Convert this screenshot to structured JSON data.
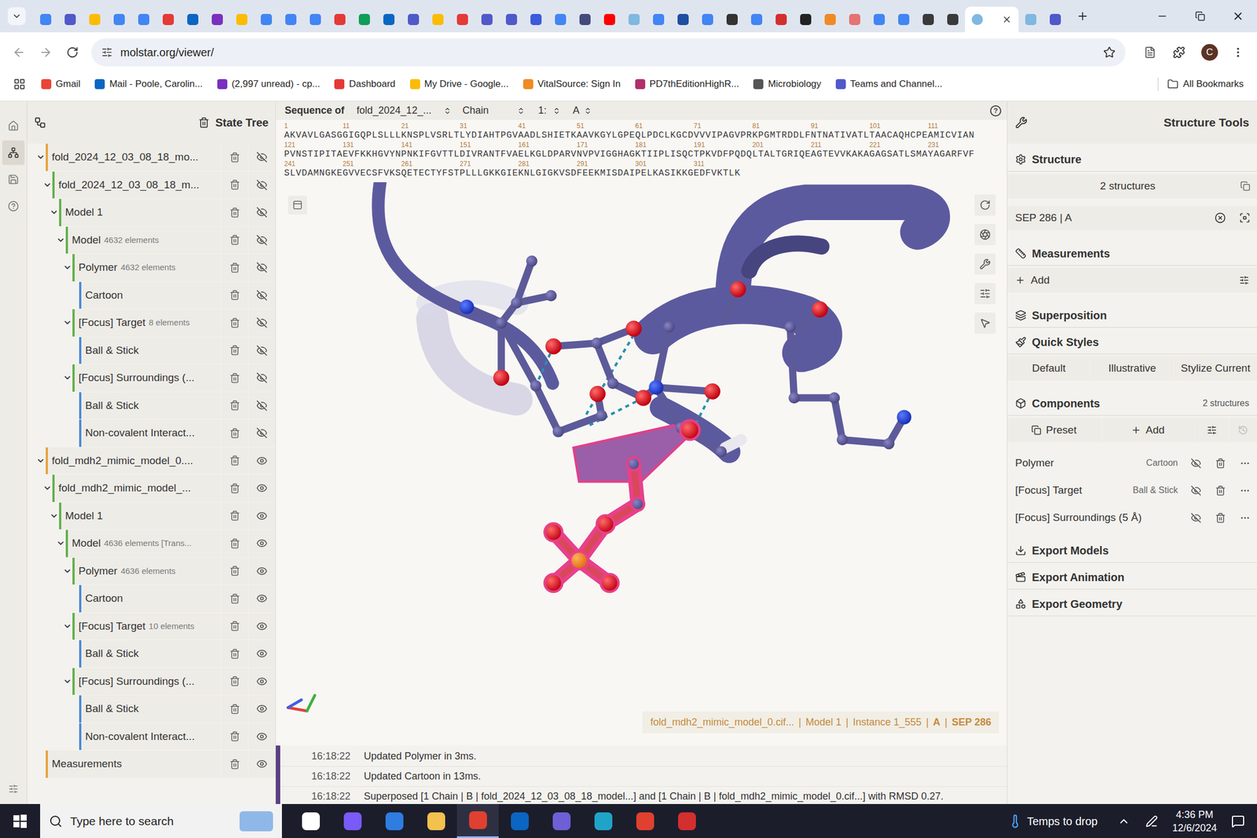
{
  "browser": {
    "tabs": [
      {
        "color": "#4285f4",
        "selected": false
      },
      {
        "color": "#5059c9",
        "selected": false
      },
      {
        "color": "#fbbc04",
        "selected": false
      },
      {
        "color": "#4285f4",
        "selected": false
      },
      {
        "color": "#4285f4",
        "selected": false
      },
      {
        "color": "#e53935",
        "selected": false
      },
      {
        "color": "#0a66c2",
        "selected": false
      },
      {
        "color": "#7b2fbe",
        "selected": false
      },
      {
        "color": "#fbbc04",
        "selected": false
      },
      {
        "color": "#4285f4",
        "selected": false
      },
      {
        "color": "#4285f4",
        "selected": false
      },
      {
        "color": "#4285f4",
        "selected": false
      },
      {
        "color": "#e53935",
        "selected": false
      },
      {
        "color": "#0f9d58",
        "selected": false
      },
      {
        "color": "#0a66c2",
        "selected": false
      },
      {
        "color": "#5059c9",
        "selected": false
      },
      {
        "color": "#fbbc04",
        "selected": false
      },
      {
        "color": "#e53935",
        "selected": false
      },
      {
        "color": "#5059c9",
        "selected": false
      },
      {
        "color": "#5059c9",
        "selected": false
      },
      {
        "color": "#3b5bdb",
        "selected": false
      },
      {
        "color": "#4285f4",
        "selected": false
      },
      {
        "color": "#444a7a",
        "selected": false
      },
      {
        "color": "#ff0000",
        "selected": false
      },
      {
        "color": "#7fb8e0",
        "selected": false
      },
      {
        "color": "#4285f4",
        "selected": false
      },
      {
        "color": "#1e4fa0",
        "selected": false
      },
      {
        "color": "#4285f4",
        "selected": false
      },
      {
        "color": "#333333",
        "selected": false
      },
      {
        "color": "#4285f4",
        "selected": false
      },
      {
        "color": "#d32f2f",
        "selected": false
      },
      {
        "color": "#222222",
        "selected": false
      },
      {
        "color": "#f08a24",
        "selected": false
      },
      {
        "color": "#e57373",
        "selected": false
      },
      {
        "color": "#4285f4",
        "selected": false
      },
      {
        "color": "#4285f4",
        "selected": false
      },
      {
        "color": "#3a3a3a",
        "selected": false
      },
      {
        "color": "#3a3a3a",
        "selected": false
      },
      {
        "color": "#7fb8e0",
        "selected": true
      },
      {
        "color": "#7fb8e0",
        "selected": false
      },
      {
        "color": "#5059c9",
        "selected": false
      }
    ],
    "address": "molstar.org/viewer/",
    "profile": "C",
    "bookmarks": [
      {
        "label": "Gmail",
        "color": "#ea4335"
      },
      {
        "label": "Mail - Poole, Carolin...",
        "color": "#0a66c2"
      },
      {
        "label": "(2,997 unread) - cp...",
        "color": "#7b2fbe"
      },
      {
        "label": "Dashboard",
        "color": "#e53935"
      },
      {
        "label": "My Drive - Google...",
        "color": "#fbbc04"
      },
      {
        "label": "VitalSource: Sign In",
        "color": "#f08a24"
      },
      {
        "label": "PD7thEditionHighR...",
        "color": "#b0306a"
      },
      {
        "label": "Microbiology",
        "color": "#555555"
      },
      {
        "label": "Teams and Channel...",
        "color": "#5059c9"
      }
    ],
    "all_bookmarks": "All Bookmarks"
  },
  "left_nav": [
    {
      "selected": false
    },
    {
      "selected": true
    },
    {
      "selected": false
    },
    {
      "selected": false
    }
  ],
  "state_tree": {
    "title": "State Tree",
    "rows": [
      {
        "label": "fold_2024_12_03_08_18_mo...",
        "depth": 0,
        "kind": "group",
        "expanded": true,
        "visible": false,
        "color": "#e8a33c"
      },
      {
        "label": "fold_2024_12_03_08_18_m...",
        "depth": 1,
        "kind": "group",
        "expanded": true,
        "visible": false,
        "color": "#62b04c"
      },
      {
        "label": "Model 1",
        "depth": 2,
        "kind": "group",
        "expanded": true,
        "visible": false,
        "color": "#62b04c"
      },
      {
        "label": "Model",
        "count": "4632 elements",
        "depth": 3,
        "kind": "group",
        "expanded": true,
        "visible": false,
        "color": "#62b04c"
      },
      {
        "label": "Polymer",
        "count": "4632 elements",
        "depth": 4,
        "kind": "group",
        "expanded": true,
        "visible": false,
        "color": "#62b04c"
      },
      {
        "label": "Cartoon",
        "depth": 5,
        "kind": "leaf",
        "expanded": false,
        "visible": false,
        "color": "#4a8bd6"
      },
      {
        "label": "[Focus] Target",
        "count": "8 elements",
        "depth": 4,
        "kind": "group",
        "expanded": true,
        "visible": false,
        "color": "#62b04c"
      },
      {
        "label": "Ball & Stick",
        "depth": 5,
        "kind": "leaf",
        "expanded": false,
        "visible": false,
        "color": "#4a8bd6"
      },
      {
        "label": "[Focus] Surroundings (...",
        "depth": 4,
        "kind": "group",
        "expanded": true,
        "visible": false,
        "color": "#62b04c"
      },
      {
        "label": "Ball & Stick",
        "depth": 5,
        "kind": "leaf",
        "expanded": false,
        "visible": false,
        "color": "#4a8bd6"
      },
      {
        "label": "Non-covalent Interact...",
        "depth": 5,
        "kind": "leaf",
        "expanded": false,
        "visible": false,
        "color": "#4a8bd6"
      },
      {
        "label": "fold_mdh2_mimic_model_0....",
        "depth": 0,
        "kind": "group",
        "expanded": true,
        "visible": true,
        "color": "#e8a33c"
      },
      {
        "label": "fold_mdh2_mimic_model_...",
        "depth": 1,
        "kind": "group",
        "expanded": true,
        "visible": true,
        "color": "#62b04c"
      },
      {
        "label": "Model 1",
        "depth": 2,
        "kind": "group",
        "expanded": true,
        "visible": true,
        "color": "#62b04c"
      },
      {
        "label": "Model",
        "count": "4636 elements [Trans...",
        "depth": 3,
        "kind": "group",
        "expanded": true,
        "visible": true,
        "color": "#62b04c"
      },
      {
        "label": "Polymer",
        "count": "4636 elements",
        "depth": 4,
        "kind": "group",
        "expanded": true,
        "visible": true,
        "color": "#62b04c"
      },
      {
        "label": "Cartoon",
        "depth": 5,
        "kind": "leaf",
        "expanded": false,
        "visible": true,
        "color": "#4a8bd6"
      },
      {
        "label": "[Focus] Target",
        "count": "10 elements",
        "depth": 4,
        "kind": "group",
        "expanded": true,
        "visible": true,
        "color": "#62b04c"
      },
      {
        "label": "Ball & Stick",
        "depth": 5,
        "kind": "leaf",
        "expanded": false,
        "visible": true,
        "color": "#4a8bd6"
      },
      {
        "label": "[Focus] Surroundings (...",
        "depth": 4,
        "kind": "group",
        "expanded": true,
        "visible": true,
        "color": "#62b04c"
      },
      {
        "label": "Ball & Stick",
        "depth": 5,
        "kind": "leaf",
        "expanded": false,
        "visible": true,
        "color": "#4a8bd6"
      },
      {
        "label": "Non-covalent Interact...",
        "depth": 5,
        "kind": "leaf",
        "expanded": false,
        "visible": true,
        "color": "#4a8bd6"
      },
      {
        "label": "Measurements",
        "depth": 0,
        "kind": "leaf",
        "expanded": false,
        "visible": true,
        "color": "#e8a33c"
      }
    ]
  },
  "sequence": {
    "label": "Sequence of",
    "structure": "fold_2024_12_...",
    "mode": "Chain",
    "model": "1:",
    "chain": "A",
    "help": "?",
    "lines": [
      [
        {
          "n": "1",
          "s": "AKVAVLGASG"
        },
        {
          "n": "11",
          "s": "GIGQPLSLLL"
        },
        {
          "n": "21",
          "s": "KNSPLVSRLT"
        },
        {
          "n": "31",
          "s": "LYDIAHTPGV"
        },
        {
          "n": "41",
          "s": "AADLSHIETK"
        },
        {
          "n": "51",
          "s": "AAVKGYLGPE"
        },
        {
          "n": "61",
          "s": "QLPDCLKGCD"
        },
        {
          "n": "71",
          "s": "VVVIPAGVPR"
        },
        {
          "n": "81",
          "s": "KPGMTRDDLF"
        },
        {
          "n": "91",
          "s": "NTNATIVATL"
        },
        {
          "n": "101",
          "s": "TAACAQHCPE"
        },
        {
          "n": "111",
          "s": "AMICVIAN"
        }
      ],
      [
        {
          "n": "121",
          "s": "PVNSTIPITA"
        },
        {
          "n": "131",
          "s": "EVFKKHGVYN"
        },
        {
          "n": "141",
          "s": "PNKIFGVTTL"
        },
        {
          "n": "151",
          "s": "DIVRANTFVA"
        },
        {
          "n": "161",
          "s": "ELKGLDPARV"
        },
        {
          "n": "171",
          "s": "NVPVIGGHAG"
        },
        {
          "n": "181",
          "s": "KTIIPLISQC"
        },
        {
          "n": "191",
          "s": "TPKVDFPQDQ"
        },
        {
          "n": "201",
          "s": "LTALTGRIQE"
        },
        {
          "n": "211",
          "s": "AGTEVVKAKA"
        },
        {
          "n": "221",
          "s": "GAGSATLSMA"
        },
        {
          "n": "231",
          "s": "YAGARFVF"
        }
      ],
      [
        {
          "n": "241",
          "s": "SLVDAMNGKE"
        },
        {
          "n": "251",
          "s": "GVVECSFVKS"
        },
        {
          "n": "261",
          "s": "QETECTYFST"
        },
        {
          "n": "271",
          "s": "PLLLGKKGIE"
        },
        {
          "n": "281",
          "s": "KNLGIGKVSD"
        },
        {
          "n": "291",
          "s": "FEEKMISDAI"
        },
        {
          "n": "301",
          "s": "PELKASIKKG"
        },
        {
          "n": "311",
          "s": "EDFVKTLK"
        }
      ]
    ]
  },
  "viewport": {
    "separator": "|",
    "info": [
      {
        "text": "fold_mdh2_mimic_model_0.cif...",
        "bold": false
      },
      {
        "text": "Model 1",
        "bold": false
      },
      {
        "text": "Instance 1_555",
        "bold": false
      },
      {
        "text": "A",
        "bold": true
      },
      {
        "text": "SEP 286",
        "bold": true
      }
    ]
  },
  "log": [
    {
      "time": "16:18:22",
      "message": "Updated Polymer in 3ms."
    },
    {
      "time": "16:18:22",
      "message": "Updated Cartoon in 13ms."
    },
    {
      "time": "16:18:22",
      "message": "Superposed [1 Chain | B | fold_2024_12_03_08_18_model...] and [1 Chain | B | fold_mdh2_mimic_model_0.cif...] with RMSD 0.27."
    }
  ],
  "right_panel": {
    "title": "Structure Tools",
    "structure": {
      "title": "Structure",
      "count": "2 structures",
      "selection": "SEP 286 | A"
    },
    "measurements": {
      "title": "Measurements",
      "add": "Add"
    },
    "superposition": "Superposition",
    "quick_styles": {
      "title": "Quick Styles",
      "buttons": [
        "Default",
        "Illustrative",
        "Stylize Current"
      ]
    },
    "components": {
      "title": "Components",
      "count": "2 structures",
      "preset": "Preset",
      "add": "Add",
      "items": [
        {
          "label": "Polymer",
          "type": "Cartoon",
          "visible": false
        },
        {
          "label": "[Focus] Target",
          "type": "Ball & Stick",
          "visible": false
        },
        {
          "label": "[Focus] Surroundings (5 Å)",
          "type": "",
          "visible": false
        }
      ]
    },
    "exports": [
      "Export Models",
      "Export Animation",
      "Export Geometry"
    ]
  },
  "taskbar": {
    "search_placeholder": "Type here to search",
    "apps": [
      {
        "color": "#ffffff",
        "active": false
      },
      {
        "color": "#7a5af8",
        "active": false
      },
      {
        "color": "#2f7de1",
        "active": false
      },
      {
        "color": "#f2c14e",
        "active": false
      },
      {
        "color": "#e0402f",
        "active": true
      },
      {
        "color": "#0a66c2",
        "active": false
      },
      {
        "color": "#6d5fd6",
        "active": false
      },
      {
        "color": "#1fa4c8",
        "active": false
      },
      {
        "color": "#e0402f",
        "active": false
      },
      {
        "color": "#d32f2f",
        "active": false
      }
    ],
    "weather": "Temps to drop",
    "time": "4:36 PM",
    "date": "12/6/2024"
  }
}
